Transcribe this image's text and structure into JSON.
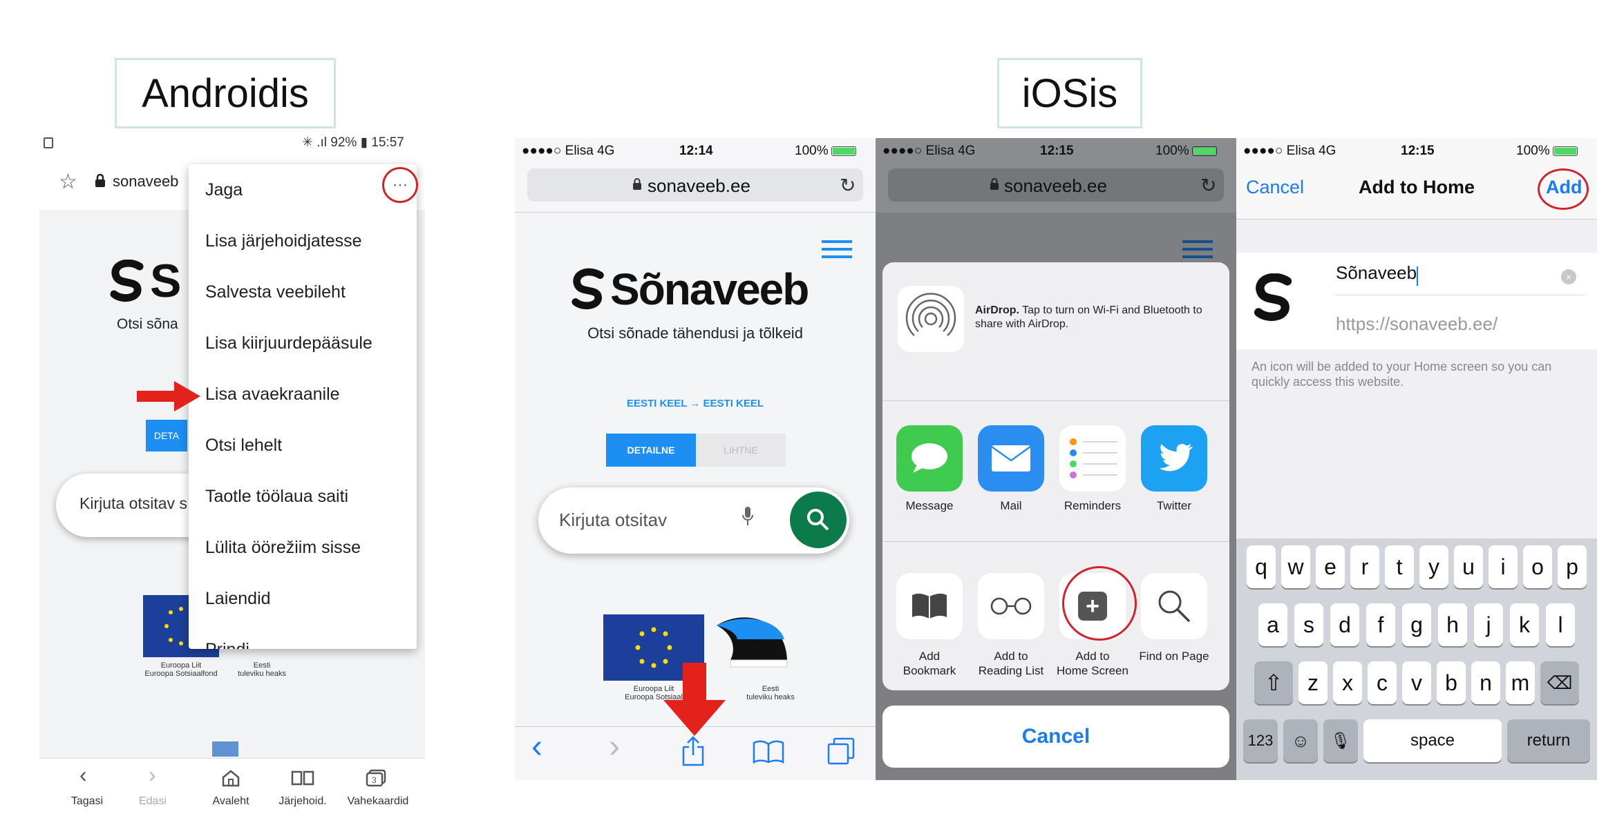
{
  "labels": {
    "android": "Androidis",
    "ios": "iOSis"
  },
  "android": {
    "status": "✳ .ıl 92% ▮ 15:57",
    "url": "sonaveeb",
    "logo_partial": "S",
    "tagline_partial": "Otsi sõna",
    "detail_partial": "DETA",
    "search_placeholder": "Kirjuta otsitav s",
    "menu": [
      "Jaga",
      "Lisa järjehoidjatesse",
      "Salvesta veebileht",
      "Lisa kiirjuurdepääsule",
      "Lisa avaekraanile",
      "Otsi lehelt",
      "Taotle töölaua saiti",
      "Lülita öörežiim sisse",
      "Laiendid",
      "Prindi"
    ],
    "eu_caption": "Euroopa Liit\nEuroopa Sotsiaalfond",
    "ee_caption": "Eesti\ntuleviku heaks",
    "nav": [
      "Tagasi",
      "Edasi",
      "Avaleht",
      "Järjehoid.",
      "Vahekaardid"
    ]
  },
  "ios1": {
    "carrier": "●●●●○ Elisa  4G",
    "time": "12:14",
    "battery": "100%",
    "url": "sonaveeb.ee",
    "logo": "Sõnaveeb",
    "tagline": "Otsi sõnade tähendusi ja tõlkeid",
    "lang": "EESTI KEEL → EESTI KEEL",
    "tab_detail": "DETAILNE",
    "tab_simple": "LIHTNE",
    "search_placeholder": "Kirjuta otsitav",
    "eu_caption": "Euroopa Liit\nEuroopa Sotsiaal",
    "ee_caption": "Eesti\ntuleviku heaks"
  },
  "ios2": {
    "carrier": "●●●●○ Elisa  4G",
    "time": "12:15",
    "battery": "100%",
    "url": "sonaveeb.ee",
    "airdrop_title": "AirDrop.",
    "airdrop_text": "Tap to turn on Wi-Fi and Bluetooth to share with AirDrop.",
    "apps": [
      "Message",
      "Mail",
      "Reminders",
      "Twitter"
    ],
    "actions": [
      "Add\nBookmark",
      "Add to\nReading List",
      "Add to\nHome Screen",
      "Find on Page"
    ],
    "cancel": "Cancel"
  },
  "ios3": {
    "carrier": "●●●●○ Elisa  4G",
    "time": "12:15",
    "battery": "100%",
    "cancel": "Cancel",
    "title": "Add to Home",
    "add": "Add",
    "name_value": "Sõnaveeb",
    "url_value": "https://sonaveeb.ee/",
    "info": "An icon will be added to your Home screen so you can quickly access this website.",
    "kb_row1": [
      "q",
      "w",
      "e",
      "r",
      "t",
      "y",
      "u",
      "i",
      "o",
      "p"
    ],
    "kb_row2": [
      "a",
      "s",
      "d",
      "f",
      "g",
      "h",
      "j",
      "k",
      "l"
    ],
    "kb_row3": [
      "z",
      "x",
      "c",
      "v",
      "b",
      "n",
      "m"
    ],
    "kb_123": "123",
    "kb_space": "space",
    "kb_return": "return"
  },
  "colors": {
    "highlight_ring": "#d0232b",
    "arrow": "#e3231b",
    "ios_blue": "#1a7bf2",
    "sonaveeb_green": "#0d7a4c",
    "sonaveeb_blue": "#1d8ff2"
  }
}
